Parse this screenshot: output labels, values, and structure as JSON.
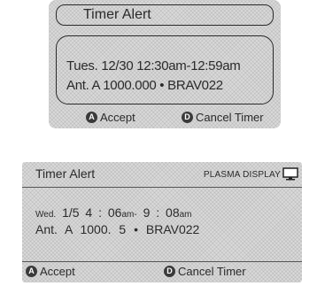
{
  "panel1": {
    "title": "Timer  Alert",
    "line1": "Tues. 12/30 12:30am-12:59am",
    "line2": "Ant. A 1000.000 • BRAV022",
    "accept": {
      "key": "A",
      "label": "Accept"
    },
    "cancel": {
      "key": "D",
      "label": "Cancel Timer"
    }
  },
  "panel2": {
    "title": "Timer  Alert",
    "brand": "PLASMA DISPLAY",
    "brand_icon": "tv-icon",
    "line1": {
      "day": "Wed.",
      "date": "1/5",
      "start": "4 : 06",
      "start_suffix": "am-",
      "end": "9 : 08",
      "end_suffix": "am"
    },
    "line2": "Ant.  A   1000. 5   • BRAV022",
    "accept": {
      "key": "A",
      "label": "Accept"
    },
    "cancel": {
      "key": "D",
      "label": "Cancel Timer"
    }
  }
}
